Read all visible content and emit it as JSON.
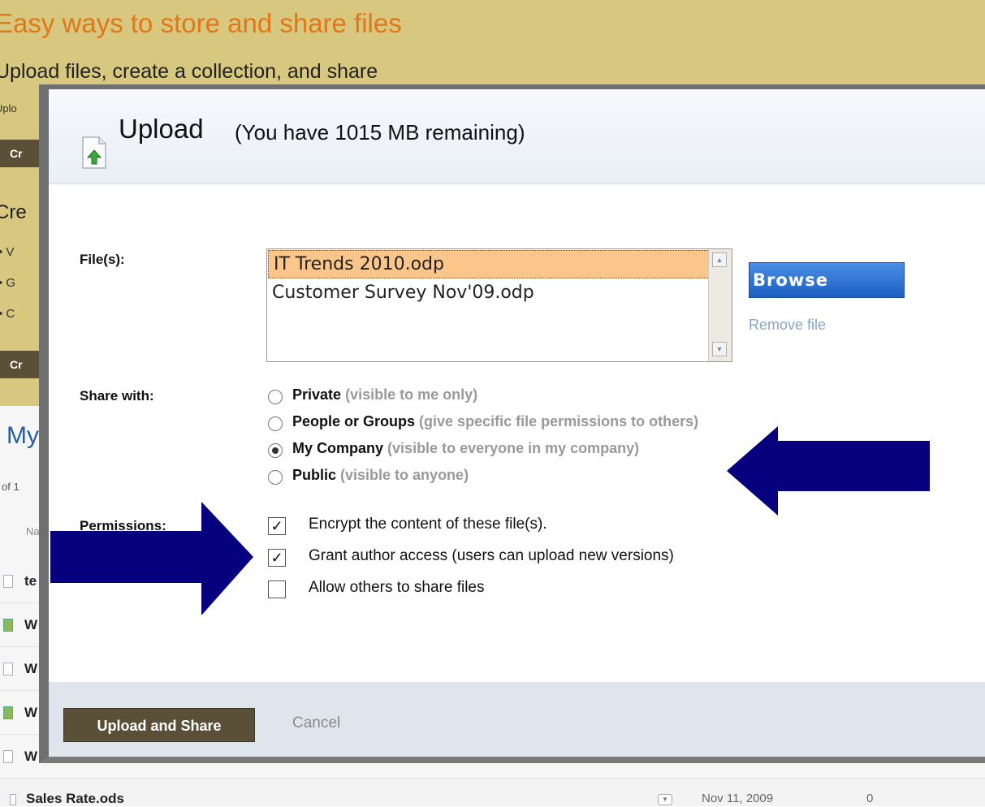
{
  "background": {
    "hero_title": "Easy ways to store and share files",
    "hero_subtitle": "Upload files, create a collection, and share",
    "hero_small": "Uplo",
    "buttons": [
      "Cr",
      "Cr"
    ],
    "create_heading": "Cre",
    "bullets": [
      "V",
      "G",
      "C"
    ],
    "my_heading": "My",
    "pager": "of 1",
    "column_name": "Na",
    "rows": [
      "te",
      "W",
      "W",
      "W",
      "W"
    ],
    "last_row": {
      "name": "Sales Rate.ods",
      "date": "Nov 11, 2009",
      "count": "0"
    }
  },
  "dialog": {
    "title": "Upload",
    "quota": "(You have 1015 MB remaining)",
    "files_label": "File(s):",
    "files": [
      "IT Trends 2010.odp",
      "Customer Survey Nov'09.odp"
    ],
    "selected_file_index": 0,
    "browse_label": "Browse",
    "remove_label": "Remove file",
    "share_label": "Share with:",
    "share_options": [
      {
        "name": "Private",
        "desc": "(visible to me only)",
        "selected": false
      },
      {
        "name": "People or Groups",
        "desc": "(give specific file permissions to others)",
        "selected": false
      },
      {
        "name": "My Company",
        "desc": "(visible to everyone in my company)",
        "selected": true
      },
      {
        "name": "Public",
        "desc": "(visible to anyone)",
        "selected": false
      }
    ],
    "permissions_label": "Permissions:",
    "permissions": [
      {
        "label": "Encrypt the content of these file(s).",
        "checked": true,
        "mark": "✓"
      },
      {
        "label": "Grant author access (users can upload new versions)",
        "checked": true,
        "mark": "✓"
      },
      {
        "label": "Allow others to share files",
        "checked": false,
        "mark": ""
      }
    ],
    "upload_button": "Upload and Share",
    "cancel_label": "Cancel"
  },
  "colors": {
    "hero_bg": "#d8c77e",
    "hero_title": "#e0781a",
    "primary_button": "#5a5038",
    "browse_button": "#2b6fd4",
    "annotation_arrow": "#06007e",
    "selected_file": "#fcc68a"
  },
  "icons": {
    "upload": "upload-file-icon",
    "arrows": [
      "annotation-arrow-left",
      "annotation-arrow-right"
    ]
  }
}
